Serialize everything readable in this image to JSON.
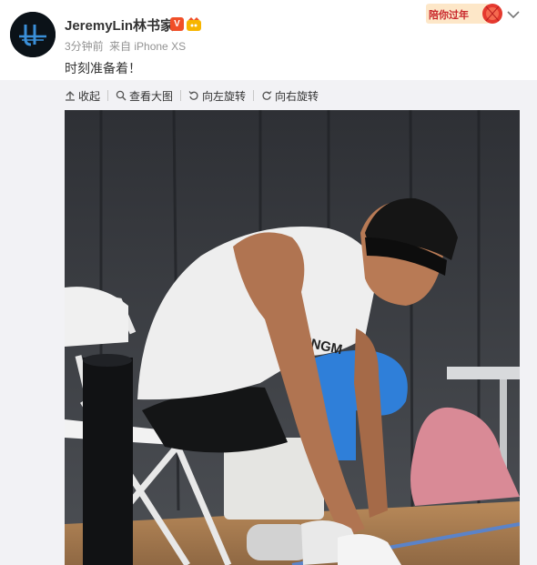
{
  "post": {
    "username": "JeremyLin林书家",
    "verified_mark": "V",
    "time": "3分钟前",
    "source": "来自 iPhone XS",
    "text": "时刻准备着！"
  },
  "badge": {
    "text": "陪你过年"
  },
  "toolbar": {
    "collapse_label": "收起",
    "view_large_label": "查看大图",
    "rotate_left_label": "向左旋转",
    "rotate_right_label": "向右旋转"
  },
  "photo": {
    "shirt_text": "RINGM"
  },
  "colors": {
    "verified": "#f04f28",
    "badge_red": "#c9272b",
    "panel_bg": "#f2f2f5",
    "text": "#333333",
    "muted": "#939393"
  },
  "icons": [
    "avatar-logo-icon",
    "verified-icon",
    "member-icon",
    "chevron-down-icon",
    "collapse-icon",
    "search-icon",
    "rotate-left-icon",
    "rotate-right-icon"
  ]
}
